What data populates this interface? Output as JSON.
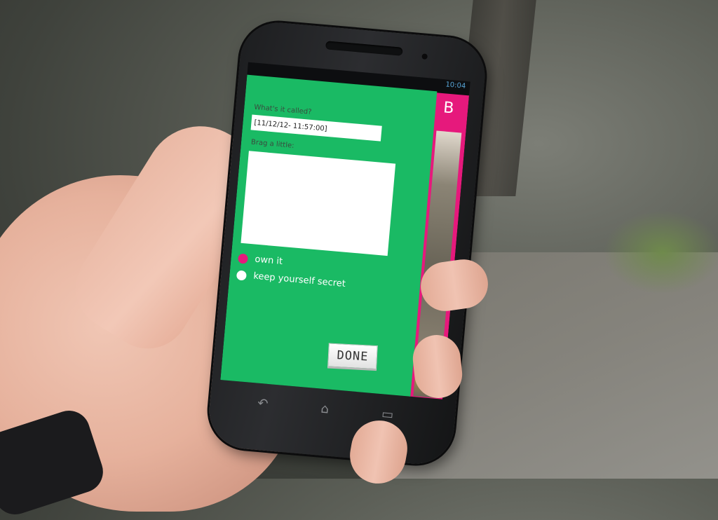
{
  "status": {
    "time": "10:04"
  },
  "side_panel": {
    "letter": "B"
  },
  "form": {
    "name_label": "What's it called?",
    "name_value": "[11/12/12- 11:57:00]",
    "brag_label": "Brag a little:",
    "brag_value": "",
    "options": [
      {
        "label": "own it",
        "selected": true
      },
      {
        "label": "keep yourself secret",
        "selected": false
      }
    ],
    "done_label": "DONE"
  },
  "colors": {
    "panel_green": "#1aba64",
    "accent_pink": "#e6197c",
    "status_blue": "#58a6d8"
  },
  "nav": {
    "back_icon": "back-arrow-icon",
    "home_icon": "home-icon",
    "recent_icon": "recent-apps-icon"
  }
}
